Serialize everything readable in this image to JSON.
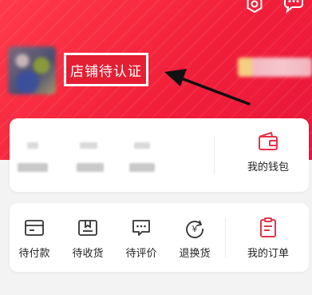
{
  "header": {
    "store_status": "店铺待认证"
  },
  "assets": {
    "wallet_label": "我的钱包"
  },
  "orders": {
    "items": [
      {
        "label": "待付款",
        "icon": "payment-pending-icon"
      },
      {
        "label": "待收货",
        "icon": "package-icon"
      },
      {
        "label": "待评价",
        "icon": "review-icon"
      },
      {
        "label": "退换货",
        "icon": "refund-icon"
      }
    ],
    "all_label": "我的订单"
  },
  "colors": {
    "brand_red": "#ee1e3c",
    "icon_dark": "#333333",
    "icon_accent": "#e8334a"
  }
}
